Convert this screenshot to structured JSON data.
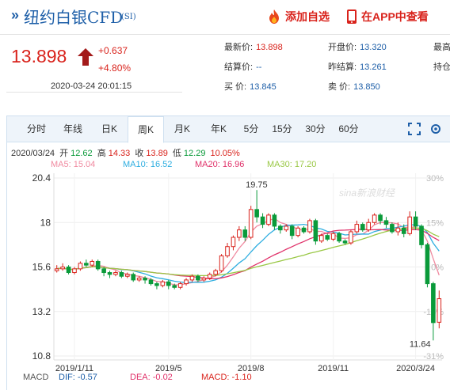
{
  "header": {
    "arrows": "»",
    "title": "纽约白银CFD",
    "symbol": "(SI)",
    "add_label": "添加自选",
    "app_label": "在APP中查看"
  },
  "quote": {
    "price": "13.898",
    "change": "+0.637",
    "percent": "+4.80%",
    "time": "2020-03-24  20:01:15",
    "fields": [
      {
        "label": "最新价:",
        "value": "13.898",
        "color": "#d9231c"
      },
      {
        "label": "开盘价:",
        "value": "13.320",
        "color": "#1e5fa8"
      },
      {
        "label": "最高",
        "value": "",
        "color": "#333333"
      },
      {
        "label": "结算价:",
        "value": "--",
        "color": "#1e5fa8"
      },
      {
        "label": "昨结算:",
        "value": "13.261",
        "color": "#1e5fa8"
      },
      {
        "label": "持仓",
        "value": "",
        "color": "#333333"
      },
      {
        "label": "买  价:",
        "value": "13.845",
        "color": "#1e5fa8"
      },
      {
        "label": "卖  价:",
        "value": "13.850",
        "color": "#1e5fa8"
      }
    ]
  },
  "tabs": [
    "分时",
    "年线",
    "日K",
    "周K",
    "月K",
    "年K",
    "5分",
    "15分",
    "30分",
    "60分"
  ],
  "active_tab": "周K",
  "ohlc": {
    "date": "2020/03/24",
    "open_label": "开",
    "open": "12.62",
    "high_label": "高",
    "high": "14.33",
    "close_label": "收",
    "close": "13.89",
    "low_label": "低",
    "low": "12.29",
    "pct": "10.05%"
  },
  "ma": {
    "ma5": "MA5: 15.04",
    "ma10": "MA10: 16.52",
    "ma20": "MA20: 16.96",
    "ma30": "MA30: 17.20"
  },
  "macd": {
    "label": "MACD",
    "dif": "DIF: -0.57",
    "dea": "DEA: -0.02",
    "macd": "MACD: -1.10"
  },
  "colors": {
    "up": "#d9231c",
    "down": "#0a9a3a",
    "ma5": "#f08aa0",
    "ma10": "#2eaee0",
    "ma20": "#e0326a",
    "ma30": "#9ac846"
  },
  "chart_data": {
    "type": "candlestick",
    "y_ticks": [
      "20.4",
      "18",
      "15.6",
      "13.2",
      "10.8"
    ],
    "y_tick_values": [
      20.4,
      18,
      15.6,
      13.2,
      10.8
    ],
    "right_ticks": [
      "30%",
      "15%",
      "0%",
      "-15%",
      "-31%"
    ],
    "ylim": [
      10.8,
      20.4
    ],
    "x_ticks": [
      "2019/1/11",
      "2019/5",
      "2019/8",
      "2019/11",
      "2020/3/24"
    ],
    "x_tick_index": [
      3,
      19,
      33,
      47,
      61
    ],
    "max_label": "19.75",
    "min_label": "11.64",
    "watermark": "sina新浪财经",
    "candles": [
      [
        15.4,
        15.5,
        15.7,
        15.3
      ],
      [
        15.5,
        15.6,
        15.8,
        15.4
      ],
      [
        15.6,
        15.3,
        15.7,
        15.2
      ],
      [
        15.3,
        15.5,
        15.6,
        15.2
      ],
      [
        15.5,
        15.8,
        15.9,
        15.4
      ],
      [
        15.8,
        15.7,
        16.0,
        15.6
      ],
      [
        15.7,
        15.9,
        16.0,
        15.6
      ],
      [
        15.9,
        15.5,
        16.0,
        15.4
      ],
      [
        15.5,
        15.3,
        15.6,
        15.1
      ],
      [
        15.3,
        15.2,
        15.4,
        15.0
      ],
      [
        15.2,
        15.3,
        15.4,
        15.1
      ],
      [
        15.3,
        15.1,
        15.4,
        15.0
      ],
      [
        15.1,
        15.2,
        15.3,
        15.0
      ],
      [
        15.2,
        14.9,
        15.3,
        14.8
      ],
      [
        14.9,
        15.0,
        15.1,
        14.8
      ],
      [
        15.0,
        14.9,
        15.1,
        14.7
      ],
      [
        14.9,
        14.7,
        15.0,
        14.6
      ],
      [
        14.7,
        14.6,
        14.8,
        14.4
      ],
      [
        14.6,
        14.8,
        14.9,
        14.5
      ],
      [
        14.8,
        14.6,
        14.9,
        14.4
      ],
      [
        14.6,
        14.5,
        14.7,
        14.4
      ],
      [
        14.5,
        14.7,
        14.8,
        14.4
      ],
      [
        14.7,
        14.9,
        15.0,
        14.6
      ],
      [
        14.9,
        15.1,
        15.2,
        14.8
      ],
      [
        15.1,
        14.9,
        15.2,
        14.8
      ],
      [
        14.9,
        15.0,
        15.1,
        14.8
      ],
      [
        15.0,
        15.2,
        15.3,
        14.9
      ],
      [
        15.2,
        15.4,
        15.5,
        15.1
      ],
      [
        15.4,
        16.2,
        16.3,
        15.3
      ],
      [
        16.2,
        16.7,
        16.9,
        16.1
      ],
      [
        16.7,
        17.2,
        17.3,
        16.5
      ],
      [
        17.2,
        17.6,
        17.8,
        17.0
      ],
      [
        17.6,
        17.2,
        17.8,
        17.0
      ],
      [
        17.2,
        18.7,
        18.9,
        17.1
      ],
      [
        18.7,
        18.3,
        19.75,
        18.0
      ],
      [
        18.3,
        17.9,
        18.5,
        17.7
      ],
      [
        17.9,
        18.4,
        18.5,
        17.8
      ],
      [
        18.4,
        17.8,
        18.5,
        17.6
      ],
      [
        17.8,
        17.6,
        17.9,
        17.4
      ],
      [
        17.6,
        17.8,
        17.9,
        17.5
      ],
      [
        17.8,
        17.3,
        17.9,
        17.1
      ],
      [
        17.3,
        17.7,
        17.8,
        17.2
      ],
      [
        17.7,
        17.5,
        17.8,
        17.4
      ],
      [
        17.5,
        18.1,
        18.2,
        17.4
      ],
      [
        18.1,
        17.0,
        18.2,
        16.8
      ],
      [
        17.0,
        17.3,
        17.4,
        16.9
      ],
      [
        17.3,
        17.1,
        17.4,
        17.0
      ],
      [
        17.1,
        17.4,
        17.5,
        17.0
      ],
      [
        17.4,
        17.0,
        17.5,
        16.9
      ],
      [
        17.0,
        16.9,
        17.1,
        16.8
      ],
      [
        16.9,
        17.5,
        17.6,
        16.8
      ],
      [
        17.5,
        17.9,
        18.1,
        17.4
      ],
      [
        17.9,
        17.6,
        18.0,
        17.5
      ],
      [
        17.6,
        18.0,
        18.2,
        17.5
      ],
      [
        18.0,
        18.4,
        18.5,
        17.9
      ],
      [
        18.4,
        18.1,
        18.5,
        17.9
      ],
      [
        18.1,
        17.9,
        18.3,
        17.7
      ],
      [
        17.9,
        17.5,
        18.0,
        17.4
      ],
      [
        17.5,
        17.7,
        18.0,
        17.3
      ],
      [
        17.7,
        17.4,
        17.9,
        17.2
      ],
      [
        17.4,
        18.3,
        18.6,
        17.3
      ],
      [
        18.3,
        17.8,
        18.6,
        17.6
      ],
      [
        17.8,
        16.8,
        17.9,
        16.6
      ],
      [
        16.8,
        14.7,
        16.9,
        14.5
      ],
      [
        14.7,
        12.6,
        14.8,
        11.64
      ],
      [
        12.62,
        13.89,
        14.33,
        12.29
      ]
    ],
    "ma_labels": [
      "MA5",
      "MA10",
      "MA20",
      "MA30"
    ]
  }
}
